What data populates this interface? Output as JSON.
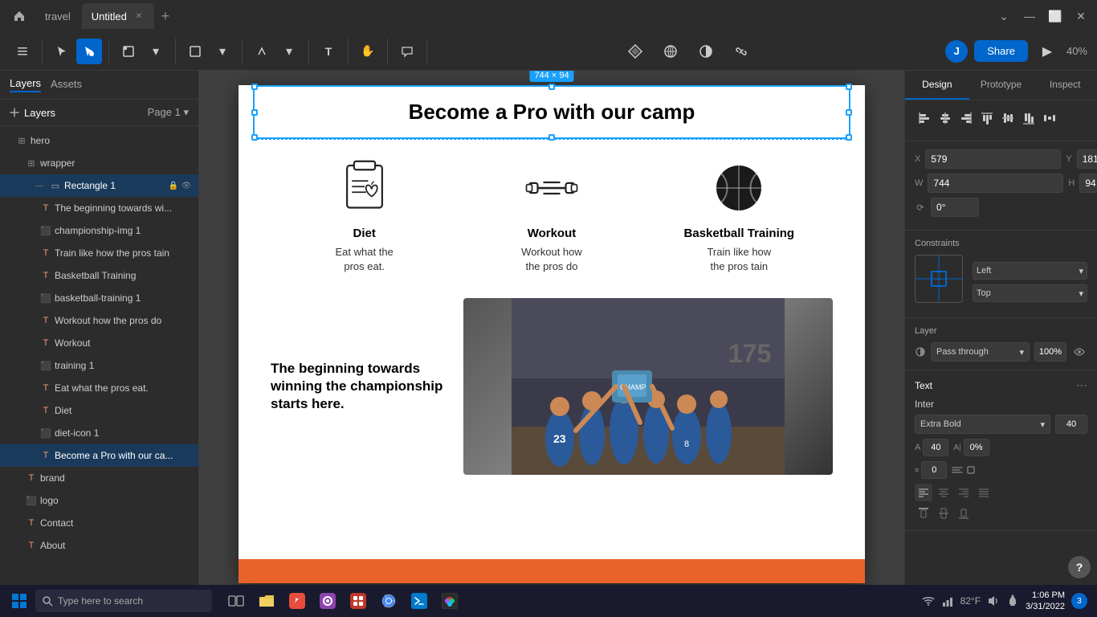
{
  "app": {
    "title": "Untitled",
    "tab_travel": "travel",
    "tab_active": "Untitled",
    "zoom": "40%"
  },
  "titlebar": {
    "home_icon": "⌂",
    "travel_tab": "travel",
    "active_tab": "Untitled",
    "add_icon": "+",
    "minimize_icon": "—",
    "maximize_icon": "⬜",
    "close_icon": "✕",
    "dropdown_icon": "⌄"
  },
  "toolbar": {
    "tools": [
      "☰",
      "▣",
      "□",
      "✎",
      "✋",
      "💬"
    ],
    "share_label": "Share",
    "avatar_initial": "J",
    "zoom_level": "40%",
    "play_icon": "▶"
  },
  "left_panel": {
    "tabs": [
      "Layers",
      "Assets"
    ],
    "page": "Page 1",
    "layers": [
      {
        "name": "hero",
        "type": "frame",
        "indent": 0,
        "icon": "+"
      },
      {
        "name": "wrapper",
        "type": "frame",
        "indent": 1,
        "icon": "+"
      },
      {
        "name": "Rectangle 1",
        "type": "rect",
        "indent": 2,
        "icon": "▭",
        "selected": true,
        "has_lock": true,
        "has_eye": true
      },
      {
        "name": "The beginning towards wi...",
        "type": "text",
        "indent": 3,
        "icon": "T"
      },
      {
        "name": "championship-img 1",
        "type": "img",
        "indent": 3,
        "icon": "⬜"
      },
      {
        "name": "Train like how the pros tain",
        "type": "text",
        "indent": 3,
        "icon": "T"
      },
      {
        "name": "Basketball Training",
        "type": "text",
        "indent": 3,
        "icon": "T"
      },
      {
        "name": "basketball-training 1",
        "type": "img",
        "indent": 3,
        "icon": "⬜"
      },
      {
        "name": "Workout how the pros do",
        "type": "text",
        "indent": 3,
        "icon": "T"
      },
      {
        "name": "Workout",
        "type": "text",
        "indent": 3,
        "icon": "T"
      },
      {
        "name": "training 1",
        "type": "img",
        "indent": 3,
        "icon": "⬜"
      },
      {
        "name": "Eat what the pros eat.",
        "type": "text",
        "indent": 3,
        "icon": "T"
      },
      {
        "name": "Diet",
        "type": "text",
        "indent": 3,
        "icon": "T"
      },
      {
        "name": "diet-icon 1",
        "type": "img",
        "indent": 3,
        "icon": "⬜"
      },
      {
        "name": "Become a Pro with our ca...",
        "type": "text",
        "indent": 3,
        "icon": "T",
        "selected_item": true
      },
      {
        "name": "brand",
        "type": "text",
        "indent": 2,
        "icon": "T"
      },
      {
        "name": "logo",
        "type": "img",
        "indent": 2,
        "icon": "⬜"
      },
      {
        "name": "Contact",
        "type": "text",
        "indent": 2,
        "icon": "T"
      },
      {
        "name": "About",
        "type": "text",
        "indent": 2,
        "icon": "T"
      }
    ]
  },
  "canvas": {
    "heading": "Become a Pro with our camp",
    "size_label": "744 × 94",
    "features": [
      {
        "title": "Diet",
        "desc_line1": "Eat what the",
        "desc_line2": "pros eat."
      },
      {
        "title": "Workout",
        "desc_line1": "Workout how",
        "desc_line2": "the pros do"
      },
      {
        "title": "Basketball Training",
        "desc_line1": "Train like how",
        "desc_line2": "the pros tain"
      }
    ],
    "championship_text": "The beginning towards winning the championship starts here.",
    "frame_label": "hero"
  },
  "right_panel": {
    "tabs": [
      "Design",
      "Prototype",
      "Inspect"
    ],
    "active_tab": "Design",
    "align_icons": [
      "⫞",
      "⊟",
      "⫟",
      "⊤",
      "⊞",
      "⊥"
    ],
    "x": "579",
    "y": "181",
    "w": "744",
    "h": "94",
    "rotation": "0°",
    "constraints": {
      "horizontal": "Left",
      "vertical": "Top"
    },
    "layer": {
      "blend_mode": "Pass through",
      "opacity": "100%"
    },
    "text_section": {
      "title": "Text",
      "font_name": "Inter",
      "font_weight": "Extra Bold",
      "font_size": "40",
      "letter_spacing": "40",
      "letter_spacing_pct": "0%",
      "line_height": "0"
    }
  },
  "taskbar": {
    "search_placeholder": "Type here to search",
    "time": "1:06 PM",
    "date": "3/31/2022",
    "notification_count": "3",
    "weather": "82°F"
  }
}
